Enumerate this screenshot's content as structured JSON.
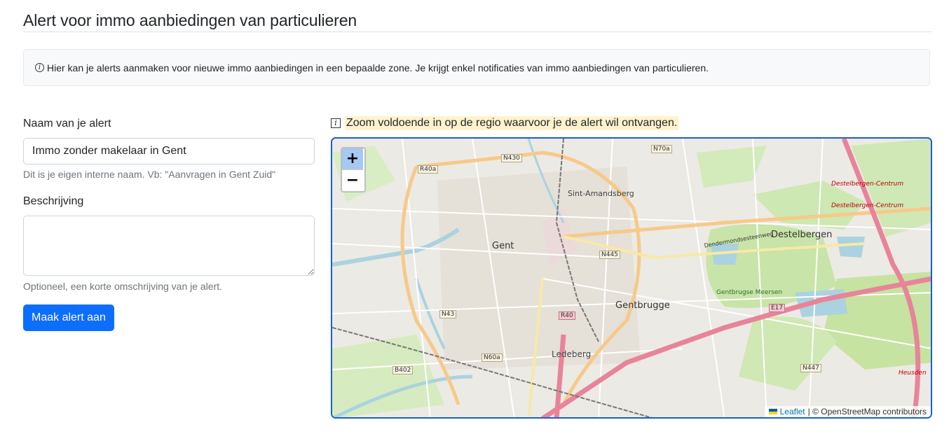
{
  "page": {
    "title": "Alert voor immo aanbiedingen van particulieren",
    "info": "Hier kan je alerts aanmaken voor nieuwe immo aanbiedingen in een bepaalde zone. Je krijgt enkel notificaties van immo aanbiedingen van particulieren."
  },
  "form": {
    "name_label": "Naam van je alert",
    "name_value": "Immo zonder makelaar in Gent",
    "name_help": "Dit is je eigen interne naam. Vb: \"Aanvragen in Gent Zuid\"",
    "desc_label": "Beschrijving",
    "desc_value": "",
    "desc_help": "Optioneel, een korte omschrijving van je alert.",
    "submit_label": "Maak alert aan"
  },
  "map": {
    "hint": "Zoom voldoende in op de regio waarvoor je de alert wil ontvangen.",
    "zoom_in": "+",
    "zoom_out": "−",
    "attribution_link": "Leaflet",
    "attribution_rest": "| © OpenStreetMap contributors",
    "labels": {
      "gent": "Gent",
      "sint_amandsberg": "Sint-Amandsberg",
      "destelbergen": "Destelbergen",
      "gentbrugge": "Gentbrugge",
      "ledeberg": "Ledeberg",
      "gentbrugse_meersen": "Gentbrugse Meersen",
      "dendermondsesteenweg": "Dendermondsesteenweg",
      "destelbergen_centrum_1": "Destelbergen-Centrum",
      "destelbergen_centrum_2": "Destelbergen-Centrum",
      "heusden": "Heusden",
      "r40a": "R40a",
      "n430": "N430",
      "n70a": "N70a",
      "n445": "N445",
      "n43": "N43",
      "r40": "R40",
      "e17": "E17",
      "n60a": "N60a",
      "b402": "B402",
      "n447": "N447"
    },
    "icons": {
      "zoom_in": "plus-icon",
      "zoom_out": "minus-icon",
      "flag": "ukraine-flag-icon"
    }
  },
  "colors": {
    "primary": "#0d6efd",
    "map_border": "#1a5ed1",
    "hint_bg": "#fff3cd",
    "info_bg": "#f8f9fa"
  }
}
